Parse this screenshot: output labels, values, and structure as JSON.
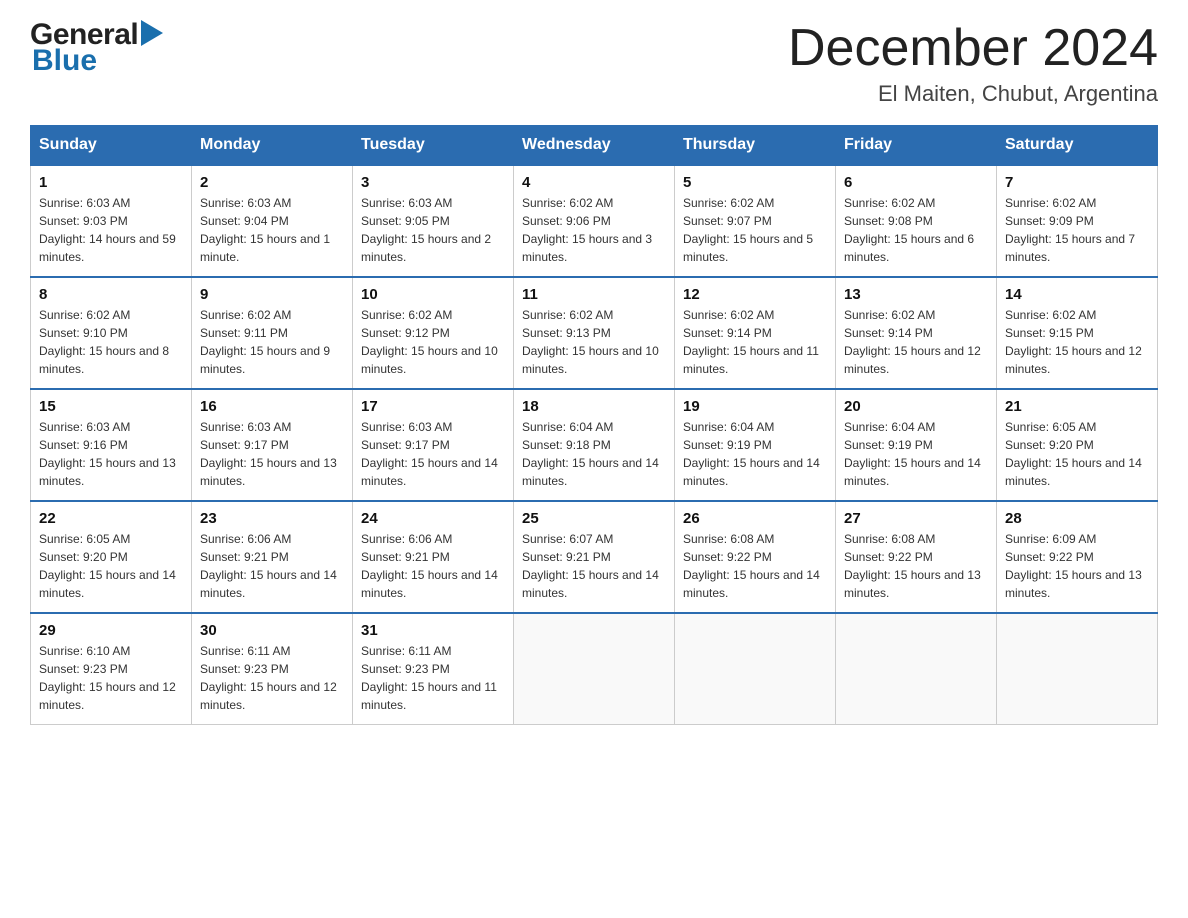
{
  "header": {
    "month_title": "December 2024",
    "location": "El Maiten, Chubut, Argentina",
    "logo_general": "General",
    "logo_blue": "Blue"
  },
  "columns": [
    "Sunday",
    "Monday",
    "Tuesday",
    "Wednesday",
    "Thursday",
    "Friday",
    "Saturday"
  ],
  "weeks": [
    [
      {
        "day": "1",
        "sunrise": "Sunrise: 6:03 AM",
        "sunset": "Sunset: 9:03 PM",
        "daylight": "Daylight: 14 hours and 59 minutes."
      },
      {
        "day": "2",
        "sunrise": "Sunrise: 6:03 AM",
        "sunset": "Sunset: 9:04 PM",
        "daylight": "Daylight: 15 hours and 1 minute."
      },
      {
        "day": "3",
        "sunrise": "Sunrise: 6:03 AM",
        "sunset": "Sunset: 9:05 PM",
        "daylight": "Daylight: 15 hours and 2 minutes."
      },
      {
        "day": "4",
        "sunrise": "Sunrise: 6:02 AM",
        "sunset": "Sunset: 9:06 PM",
        "daylight": "Daylight: 15 hours and 3 minutes."
      },
      {
        "day": "5",
        "sunrise": "Sunrise: 6:02 AM",
        "sunset": "Sunset: 9:07 PM",
        "daylight": "Daylight: 15 hours and 5 minutes."
      },
      {
        "day": "6",
        "sunrise": "Sunrise: 6:02 AM",
        "sunset": "Sunset: 9:08 PM",
        "daylight": "Daylight: 15 hours and 6 minutes."
      },
      {
        "day": "7",
        "sunrise": "Sunrise: 6:02 AM",
        "sunset": "Sunset: 9:09 PM",
        "daylight": "Daylight: 15 hours and 7 minutes."
      }
    ],
    [
      {
        "day": "8",
        "sunrise": "Sunrise: 6:02 AM",
        "sunset": "Sunset: 9:10 PM",
        "daylight": "Daylight: 15 hours and 8 minutes."
      },
      {
        "day": "9",
        "sunrise": "Sunrise: 6:02 AM",
        "sunset": "Sunset: 9:11 PM",
        "daylight": "Daylight: 15 hours and 9 minutes."
      },
      {
        "day": "10",
        "sunrise": "Sunrise: 6:02 AM",
        "sunset": "Sunset: 9:12 PM",
        "daylight": "Daylight: 15 hours and 10 minutes."
      },
      {
        "day": "11",
        "sunrise": "Sunrise: 6:02 AM",
        "sunset": "Sunset: 9:13 PM",
        "daylight": "Daylight: 15 hours and 10 minutes."
      },
      {
        "day": "12",
        "sunrise": "Sunrise: 6:02 AM",
        "sunset": "Sunset: 9:14 PM",
        "daylight": "Daylight: 15 hours and 11 minutes."
      },
      {
        "day": "13",
        "sunrise": "Sunrise: 6:02 AM",
        "sunset": "Sunset: 9:14 PM",
        "daylight": "Daylight: 15 hours and 12 minutes."
      },
      {
        "day": "14",
        "sunrise": "Sunrise: 6:02 AM",
        "sunset": "Sunset: 9:15 PM",
        "daylight": "Daylight: 15 hours and 12 minutes."
      }
    ],
    [
      {
        "day": "15",
        "sunrise": "Sunrise: 6:03 AM",
        "sunset": "Sunset: 9:16 PM",
        "daylight": "Daylight: 15 hours and 13 minutes."
      },
      {
        "day": "16",
        "sunrise": "Sunrise: 6:03 AM",
        "sunset": "Sunset: 9:17 PM",
        "daylight": "Daylight: 15 hours and 13 minutes."
      },
      {
        "day": "17",
        "sunrise": "Sunrise: 6:03 AM",
        "sunset": "Sunset: 9:17 PM",
        "daylight": "Daylight: 15 hours and 14 minutes."
      },
      {
        "day": "18",
        "sunrise": "Sunrise: 6:04 AM",
        "sunset": "Sunset: 9:18 PM",
        "daylight": "Daylight: 15 hours and 14 minutes."
      },
      {
        "day": "19",
        "sunrise": "Sunrise: 6:04 AM",
        "sunset": "Sunset: 9:19 PM",
        "daylight": "Daylight: 15 hours and 14 minutes."
      },
      {
        "day": "20",
        "sunrise": "Sunrise: 6:04 AM",
        "sunset": "Sunset: 9:19 PM",
        "daylight": "Daylight: 15 hours and 14 minutes."
      },
      {
        "day": "21",
        "sunrise": "Sunrise: 6:05 AM",
        "sunset": "Sunset: 9:20 PM",
        "daylight": "Daylight: 15 hours and 14 minutes."
      }
    ],
    [
      {
        "day": "22",
        "sunrise": "Sunrise: 6:05 AM",
        "sunset": "Sunset: 9:20 PM",
        "daylight": "Daylight: 15 hours and 14 minutes."
      },
      {
        "day": "23",
        "sunrise": "Sunrise: 6:06 AM",
        "sunset": "Sunset: 9:21 PM",
        "daylight": "Daylight: 15 hours and 14 minutes."
      },
      {
        "day": "24",
        "sunrise": "Sunrise: 6:06 AM",
        "sunset": "Sunset: 9:21 PM",
        "daylight": "Daylight: 15 hours and 14 minutes."
      },
      {
        "day": "25",
        "sunrise": "Sunrise: 6:07 AM",
        "sunset": "Sunset: 9:21 PM",
        "daylight": "Daylight: 15 hours and 14 minutes."
      },
      {
        "day": "26",
        "sunrise": "Sunrise: 6:08 AM",
        "sunset": "Sunset: 9:22 PM",
        "daylight": "Daylight: 15 hours and 14 minutes."
      },
      {
        "day": "27",
        "sunrise": "Sunrise: 6:08 AM",
        "sunset": "Sunset: 9:22 PM",
        "daylight": "Daylight: 15 hours and 13 minutes."
      },
      {
        "day": "28",
        "sunrise": "Sunrise: 6:09 AM",
        "sunset": "Sunset: 9:22 PM",
        "daylight": "Daylight: 15 hours and 13 minutes."
      }
    ],
    [
      {
        "day": "29",
        "sunrise": "Sunrise: 6:10 AM",
        "sunset": "Sunset: 9:23 PM",
        "daylight": "Daylight: 15 hours and 12 minutes."
      },
      {
        "day": "30",
        "sunrise": "Sunrise: 6:11 AM",
        "sunset": "Sunset: 9:23 PM",
        "daylight": "Daylight: 15 hours and 12 minutes."
      },
      {
        "day": "31",
        "sunrise": "Sunrise: 6:11 AM",
        "sunset": "Sunset: 9:23 PM",
        "daylight": "Daylight: 15 hours and 11 minutes."
      },
      null,
      null,
      null,
      null
    ]
  ]
}
